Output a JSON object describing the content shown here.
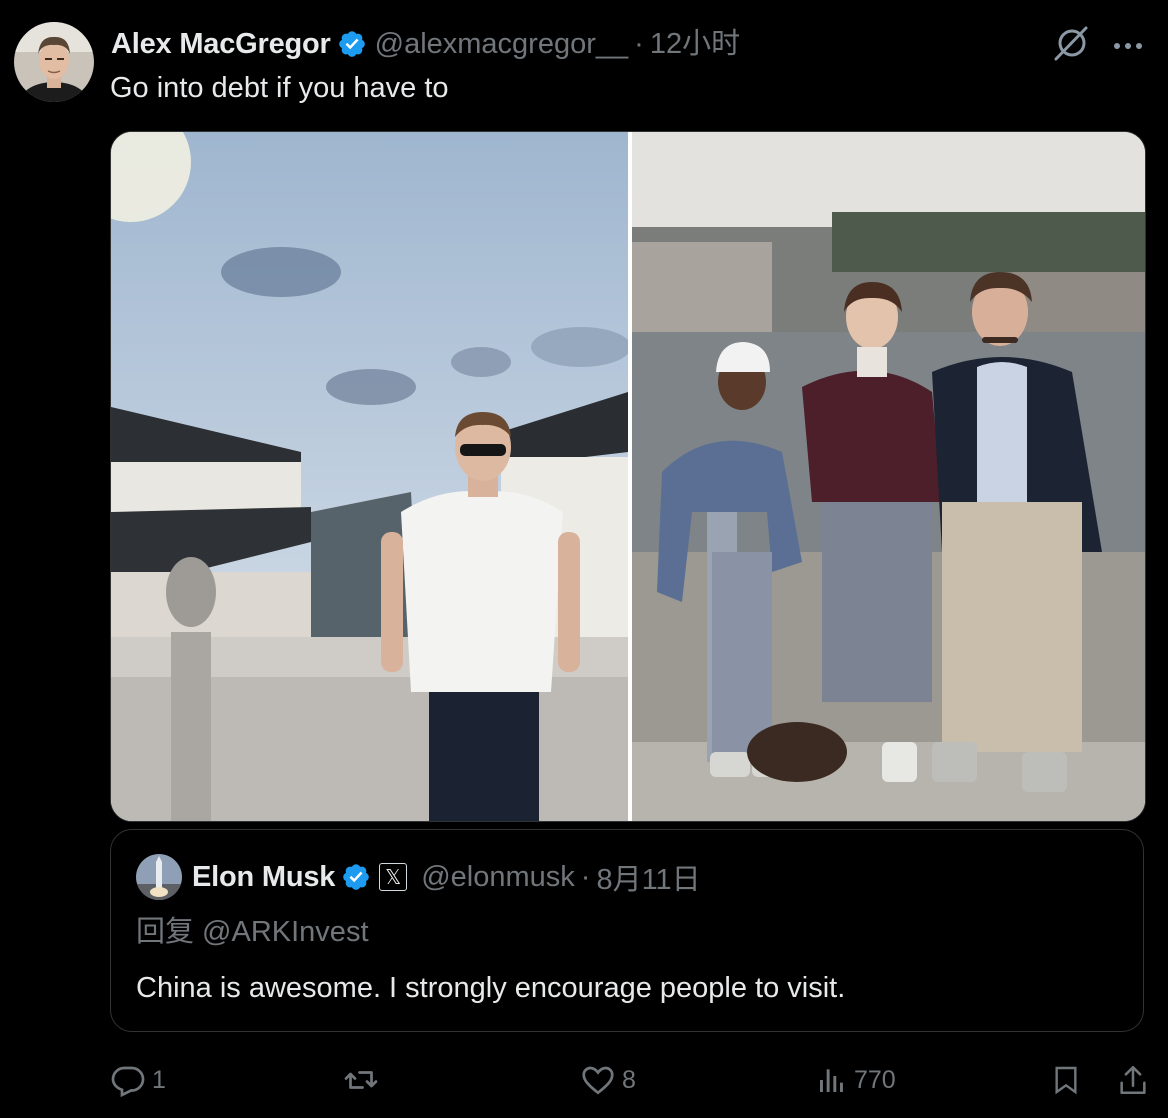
{
  "tweet": {
    "author": {
      "name": "Alex MacGregor",
      "handle": "@alexmacgregor__",
      "verified": true,
      "avatar_icon": "user-avatar"
    },
    "separator": "·",
    "time": "12小时",
    "text": "Go into debt if you have to",
    "media": [
      {
        "icon": "photo-man-on-canal-bridge"
      },
      {
        "icon": "photo-family-on-canal-bridge"
      }
    ]
  },
  "quote": {
    "author": {
      "name": "Elon Musk",
      "handle": "@elonmusk",
      "verified": true,
      "badge": "𝕏",
      "avatar_icon": "rocket-avatar"
    },
    "separator": "·",
    "time": "8月11日",
    "reply_to": "回复 @ARKInvest",
    "text": "China is awesome. I strongly encourage people to visit."
  },
  "actions": {
    "reply_count": "1",
    "retweet_count": "",
    "like_count": "8",
    "views_count": "770"
  },
  "colors": {
    "background": "#000000",
    "text_primary": "#e7e9ea",
    "text_secondary": "#71767b",
    "border": "#2f3336",
    "verified_blue": "#1d9bf0"
  }
}
